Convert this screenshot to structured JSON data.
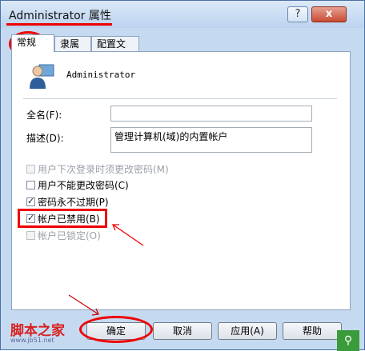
{
  "window": {
    "title": "Administrator 属性"
  },
  "titlebar": {
    "help": "?",
    "close": "x"
  },
  "tabs": [
    {
      "label": "常规"
    },
    {
      "label": "隶属于"
    },
    {
      "label": "配置文件"
    }
  ],
  "user": {
    "name": "Administrator"
  },
  "fields": {
    "full_name_label": "全名(F):",
    "full_name_value": "",
    "description_label": "描述(D):",
    "description_value": "管理计算机(域)的内置帐户"
  },
  "checkboxes": [
    {
      "label": "用户下次登录时须更改密码(M)",
      "checked": false,
      "disabled": true
    },
    {
      "label": "用户不能更改密码(C)",
      "checked": false,
      "disabled": false
    },
    {
      "label": "密码永不过期(P)",
      "checked": true,
      "disabled": false
    },
    {
      "label": "帐户已禁用(B)",
      "checked": true,
      "disabled": false
    },
    {
      "label": "帐户已锁定(O)",
      "checked": false,
      "disabled": true
    }
  ],
  "buttons": {
    "ok": "确定",
    "cancel": "取消",
    "apply": "应用(A)",
    "help": "帮助"
  },
  "watermark": {
    "text": "脚本之家",
    "url": "www.jb51.net"
  },
  "colors": {
    "highlight": "#e00000",
    "window_frame": "#c5daf1"
  }
}
